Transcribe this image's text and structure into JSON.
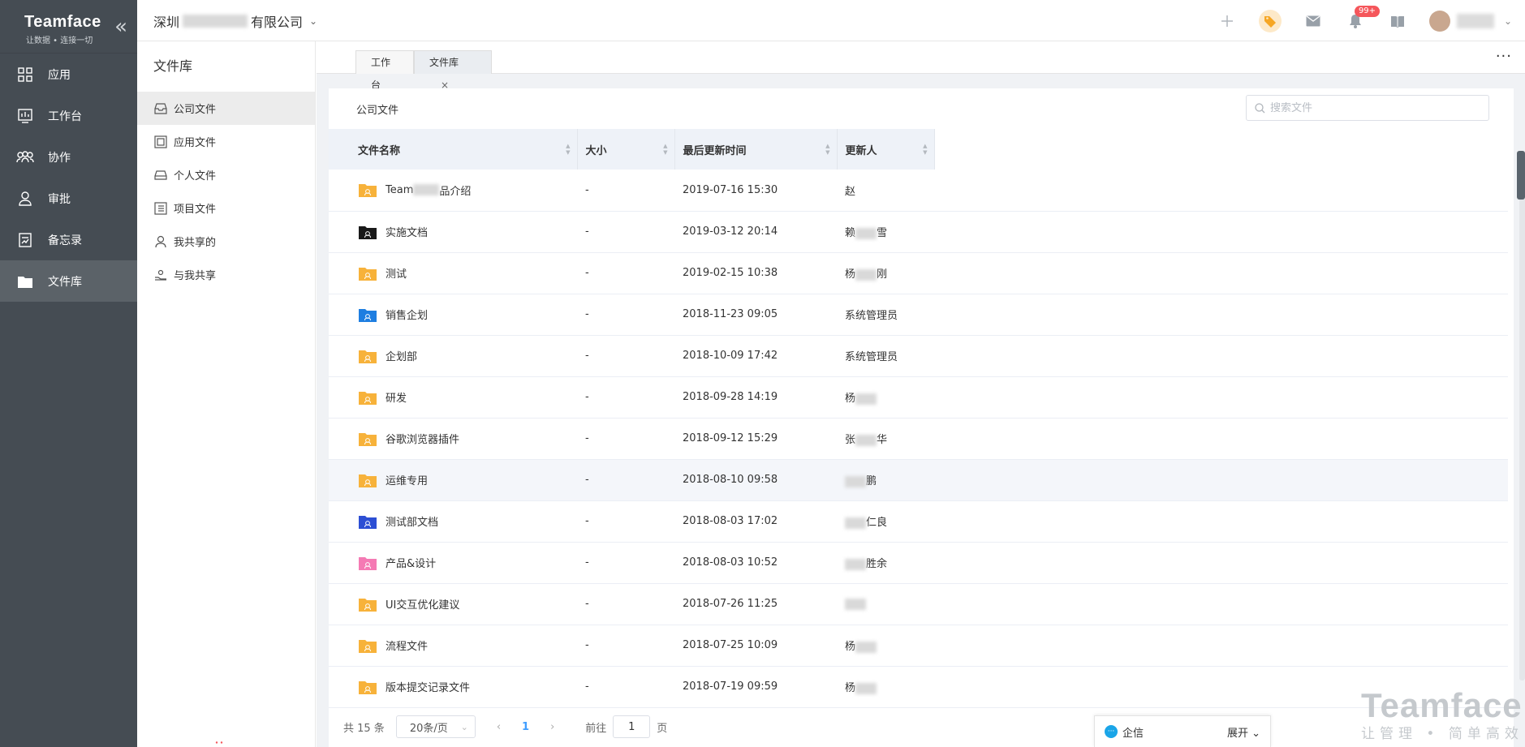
{
  "sidebar": {
    "brand": "Teamface",
    "slogan": "让数据 • 连接一切",
    "items": [
      {
        "label": "应用"
      },
      {
        "label": "工作台"
      },
      {
        "label": "协作"
      },
      {
        "label": "审批"
      },
      {
        "label": "备忘录"
      },
      {
        "label": "文件库"
      }
    ]
  },
  "topbar": {
    "company_prefix": "深圳",
    "company_suffix": "有限公司",
    "notification_badge": "99+"
  },
  "library": {
    "title": "文件库",
    "items": [
      {
        "label": "公司文件"
      },
      {
        "label": "应用文件"
      },
      {
        "label": "个人文件"
      },
      {
        "label": "项目文件"
      },
      {
        "label": "我共享的"
      },
      {
        "label": "与我共享"
      }
    ]
  },
  "tabs": [
    {
      "label": "工作台"
    },
    {
      "label": "文件库",
      "close": "×"
    }
  ],
  "more_label": "···",
  "panel": {
    "breadcrumb": "公司文件",
    "search_placeholder": "搜索文件"
  },
  "table": {
    "columns": [
      "文件名称",
      "大小",
      "最后更新时间",
      "更新人"
    ],
    "rows": [
      {
        "name": "Team",
        "name_tail": "品介绍",
        "size": "-",
        "time": "2019-07-16 15:30",
        "user": "赵",
        "folder_color": "#f7b23b"
      },
      {
        "name": "实施文档",
        "size": "-",
        "time": "2019-03-12 20:14",
        "user": "赖",
        "user_tail": "雪",
        "folder_color": "#1a1a1a"
      },
      {
        "name": "测试",
        "size": "-",
        "time": "2019-02-15 10:38",
        "user": "杨",
        "user_tail": "刚",
        "folder_color": "#f7b23b"
      },
      {
        "name": "销售企划",
        "size": "-",
        "time": "2018-11-23 09:05",
        "user": "系统管理员",
        "folder_color": "#1e7ee0"
      },
      {
        "name": "企划部",
        "size": "-",
        "time": "2018-10-09 17:42",
        "user": "系统管理员",
        "folder_color": "#f7b23b"
      },
      {
        "name": "研发",
        "size": "-",
        "time": "2018-09-28 14:19",
        "user": "杨",
        "user_tail": "",
        "folder_color": "#f7b23b"
      },
      {
        "name": "谷歌浏览器插件",
        "size": "-",
        "time": "2018-09-12 15:29",
        "user": "张",
        "user_tail": "华",
        "folder_color": "#f7b23b"
      },
      {
        "name": "运维专用",
        "size": "-",
        "time": "2018-08-10 09:58",
        "user": "",
        "user_tail": "鹏",
        "folder_color": "#f7b23b"
      },
      {
        "name": "测试部文档",
        "size": "-",
        "time": "2018-08-03 17:02",
        "user": "",
        "user_tail": "仁良",
        "folder_color": "#2d4fd3"
      },
      {
        "name": "产品&设计",
        "size": "-",
        "time": "2018-08-03 10:52",
        "user": "",
        "user_tail": "胜余",
        "folder_color": "#f47ab4"
      },
      {
        "name": "UI交互优化建议",
        "size": "-",
        "time": "2018-07-26 11:25",
        "user": "",
        "user_tail": "",
        "folder_color": "#f7b23b"
      },
      {
        "name": "流程文件",
        "size": "-",
        "time": "2018-07-25 10:09",
        "user": "杨",
        "user_tail": "",
        "folder_color": "#f7b23b"
      },
      {
        "name": "版本提交记录文件",
        "size": "-",
        "time": "2018-07-19 09:59",
        "user": "杨",
        "user_tail": "",
        "folder_color": "#f7b23b"
      }
    ]
  },
  "pagination": {
    "total": "共 15 条",
    "page_size": "20条/页",
    "current": "1",
    "goto_prefix": "前往",
    "goto_value": "1",
    "goto_suffix": "页"
  },
  "chat": {
    "label": "企信",
    "expand": "展开"
  },
  "watermark": {
    "brand": "Teamface",
    "tagline": "让管理 • 简单高效"
  }
}
